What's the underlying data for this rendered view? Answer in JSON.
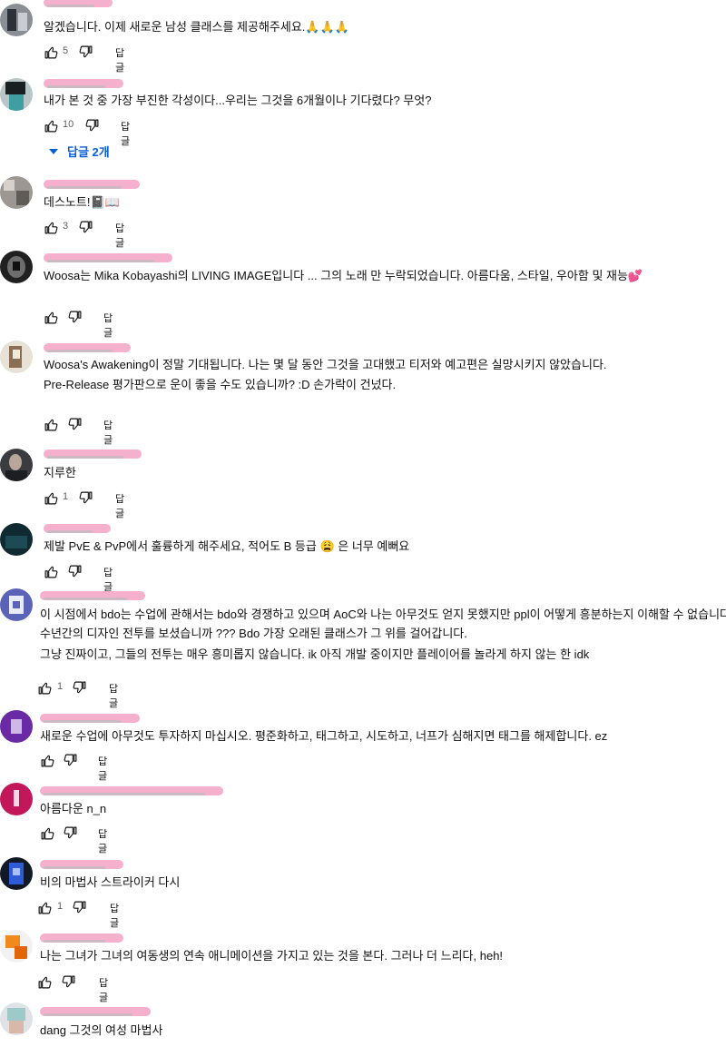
{
  "ui": {
    "reply_label": "답글"
  },
  "comments": [
    {
      "lines": [
        "알겠습니다. 이제 새로운 남성 클래스를 제공해주세요.🙏🙏🙏"
      ],
      "likes": "5"
    },
    {
      "lines": [
        "내가 본 것 중 가장 부진한 각성이다...우리는 그것을 6개월이나 기다렸다? 무엇?"
      ],
      "likes": "10",
      "replies": "답글 2개"
    },
    {
      "lines": [
        "데스노트!📓📖"
      ],
      "likes": "3"
    },
    {
      "lines": [
        "Woosa는 Mika Kobayashi의 LIVING IMAGE입니다 ... 그의 노래 만 누락되었습니다. 아름다움, 스타일, 우아함 및 재능💕"
      ],
      "likes": ""
    },
    {
      "lines": [
        "Woosa's Awakening이 정말 기대됩니다. 나는 몇 달 동안 그것을 고대했고 티저와 예고편은 실망시키지 않았습니다.",
        "Pre-Release 평가판으로 운이 좋을 수도 있습니까? :D 손가락이 건넜다."
      ],
      "likes": ""
    },
    {
      "lines": [
        "지루한"
      ],
      "likes": "1"
    },
    {
      "lines": [
        "제발 PvE & PvP에서 훌륭하게 해주세요, 적어도 B 등급 😩 은 너무 예뻐요"
      ],
      "likes": ""
    },
    {
      "lines": [
        "이 시점에서 bdo는 수업에 관해서는 bdo와 경쟁하고 있으며 AoC와 나는 아무것도 얻지 못했지만 ppl이 어떻게 흥분하는지 이해할 수 없습니다.",
        "수년간의 디자인 전투를 보셨습니까 ??? Bdo 가장 오래된 클래스가 그 위를 걸어갑니다.",
        "그냥 진짜이고, 그들의 전투는 매우 흥미롭지 않습니다. ik 아직 개발 중이지만 플레이어를 놀라게 하지 않는 한 idk"
      ],
      "likes": "1"
    },
    {
      "lines": [
        "새로운 수업에 아무것도 투자하지 마십시오. 평준화하고, 태그하고, 시도하고, 너프가 심해지면 태그를 해제합니다. ez"
      ],
      "likes": ""
    },
    {
      "lines": [
        "아름다운 n_n"
      ],
      "likes": ""
    },
    {
      "lines": [
        "비의 마법사 스트라이커 다시"
      ],
      "likes": "1"
    },
    {
      "lines": [
        "나는 그녀가 그녀의 여동생의 연속 애니메이션을 가지고 있는 것을 본다. 그러나 더 느리다, heh!"
      ],
      "likes": ""
    },
    {
      "lines": [
        "dang 그것의 여성 마법사"
      ],
      "likes": ""
    }
  ]
}
